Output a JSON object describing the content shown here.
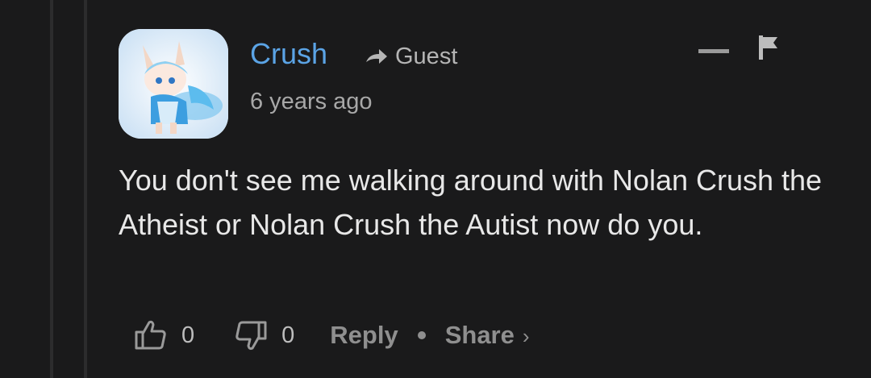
{
  "comment": {
    "author": "Crush",
    "role": "Guest",
    "timestamp": "6 years ago",
    "body": "You don't see me walking around with Nolan Crush the Atheist or Nolan Crush the Autist now do you.",
    "avatar_icon": "anime-character-avatar"
  },
  "header_actions": {
    "collapse_icon": "minus-icon",
    "flag_icon": "flag-icon"
  },
  "footer": {
    "upvote_icon": "thumbs-up-icon",
    "upvotes": "0",
    "downvote_icon": "thumbs-down-icon",
    "downvotes": "0",
    "reply_label": "Reply",
    "share_label": "Share",
    "share_chevron": "›"
  },
  "colors": {
    "background": "#1a1a1b",
    "author": "#5ba4e6",
    "muted": "#9a9a9a",
    "text": "#e8e8e8"
  }
}
